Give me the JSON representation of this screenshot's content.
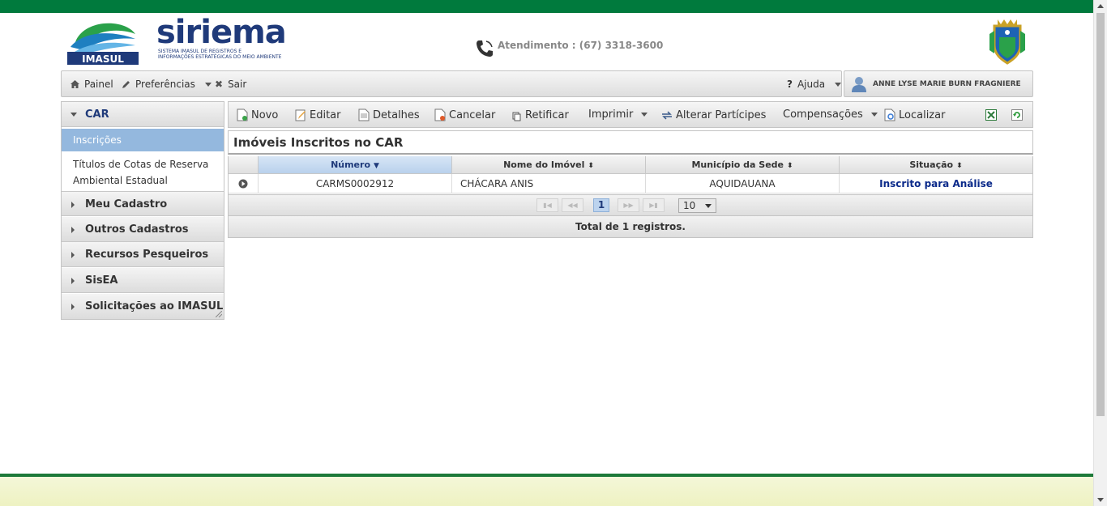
{
  "header": {
    "logo_imasul_text": "IMASUL",
    "logo_siriema_text": "siriema",
    "logo_siriema_sub1": "SISTEMA IMASUL DE REGISTROS E",
    "logo_siriema_sub2": "INFORMAÇÕES ESTRATÉGICAS DO MEIO AMBIENTE",
    "atendimento": "Atendimento : (67) 3318-3600"
  },
  "menu": {
    "painel": "Painel",
    "preferencias": "Preferências",
    "sair": "Sair",
    "ajuda": "Ajuda",
    "user": "ANNE LYSE MARIE BURN FRAGNIERE"
  },
  "sidebar": {
    "car": "CAR",
    "inscricoes": "Inscrições",
    "titulos": "Títulos de Cotas de Reserva Ambiental Estadual",
    "sections": [
      "Meu Cadastro",
      "Outros Cadastros",
      "Recursos Pesqueiros",
      "SisEA",
      "Solicitações ao IMASUL"
    ]
  },
  "toolbar": {
    "novo": "Novo",
    "editar": "Editar",
    "detalhes": "Detalhes",
    "cancelar": "Cancelar",
    "retificar": "Retificar",
    "imprimir": "Imprimir",
    "alterar": "Alterar Partícipes",
    "compensacoes": "Compensações",
    "localizar": "Localizar"
  },
  "panel": {
    "title": "Imóveis Inscritos no CAR"
  },
  "grid": {
    "columns": [
      "Número",
      "Nome do Imóvel",
      "Município da Sede",
      "Situação"
    ],
    "rows": [
      {
        "numero": "CARMS0002912",
        "nome": "CHÁCARA ANIS",
        "municipio": "AQUIDAUANA",
        "situacao": "Inscrito para Análise"
      }
    ]
  },
  "pager": {
    "current_page": "1",
    "page_size": "10",
    "total": "Total de 1 registros."
  },
  "colors": {
    "brand_green": "#007a3d",
    "brand_blue": "#1f3a7a",
    "selected_bg": "#94b8de"
  }
}
